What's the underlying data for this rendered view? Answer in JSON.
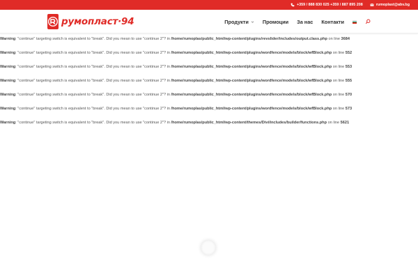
{
  "topbar": {
    "phones": "+359 / 888 830 025 +359 / 887 895 208",
    "email": "rumoplast@abv.bg",
    "phone_icon": "phone-icon",
    "email_icon": "envelope-icon"
  },
  "brand": {
    "name": "румопласт·94",
    "mark_icon": "company-logo-mark",
    "color": "#e02b27"
  },
  "nav": {
    "items": [
      {
        "label": "Продукти",
        "has_submenu": true
      },
      {
        "label": "Промоции"
      },
      {
        "label": "За нас"
      },
      {
        "label": "Контакти"
      }
    ],
    "language_icon": "bulgarian-flag-icon",
    "search_icon": "search-icon"
  },
  "warnings": [
    {
      "label": "Warning",
      "message": ": \"continue\" targeting switch is equivalent to \"break\". Did you mean to use \"continue 2\"? in ",
      "file": "/home/rumoplas/public_html/wp-content/plugins/revslider/includes/output.class.php",
      "online": " on line ",
      "line": "3684"
    },
    {
      "label": "Warning",
      "message": ": \"continue\" targeting switch is equivalent to \"break\". Did you mean to use \"continue 2\"? in ",
      "file": "/home/rumoplas/public_html/wp-content/plugins/wordfence/models/block/wfBlock.php",
      "online": " on line ",
      "line": "552"
    },
    {
      "label": "Warning",
      "message": ": \"continue\" targeting switch is equivalent to \"break\". Did you mean to use \"continue 2\"? in ",
      "file": "/home/rumoplas/public_html/wp-content/plugins/wordfence/models/block/wfBlock.php",
      "online": " on line ",
      "line": "553"
    },
    {
      "label": "Warning",
      "message": ": \"continue\" targeting switch is equivalent to \"break\". Did you mean to use \"continue 2\"? in ",
      "file": "/home/rumoplas/public_html/wp-content/plugins/wordfence/models/block/wfBlock.php",
      "online": " on line ",
      "line": "555"
    },
    {
      "label": "Warning",
      "message": ": \"continue\" targeting switch is equivalent to \"break\". Did you mean to use \"continue 2\"? in ",
      "file": "/home/rumoplas/public_html/wp-content/plugins/wordfence/models/block/wfBlock.php",
      "online": " on line ",
      "line": "570"
    },
    {
      "label": "Warning",
      "message": ": \"continue\" targeting switch is equivalent to \"break\". Did you mean to use \"continue 2\"? in ",
      "file": "/home/rumoplas/public_html/wp-content/plugins/wordfence/models/block/wfBlock.php",
      "online": " on line ",
      "line": "573"
    },
    {
      "label": "Warning",
      "message": ": \"continue\" targeting switch is equivalent to \"break\". Did you mean to use \"continue 2\"? in ",
      "file": "/home/rumoplas/public_html/wp-content/themes/Divi/includes/builder/functions.php",
      "online": " on line ",
      "line": "5621"
    }
  ],
  "loader": {
    "icon": "loading-spinner-icon"
  }
}
